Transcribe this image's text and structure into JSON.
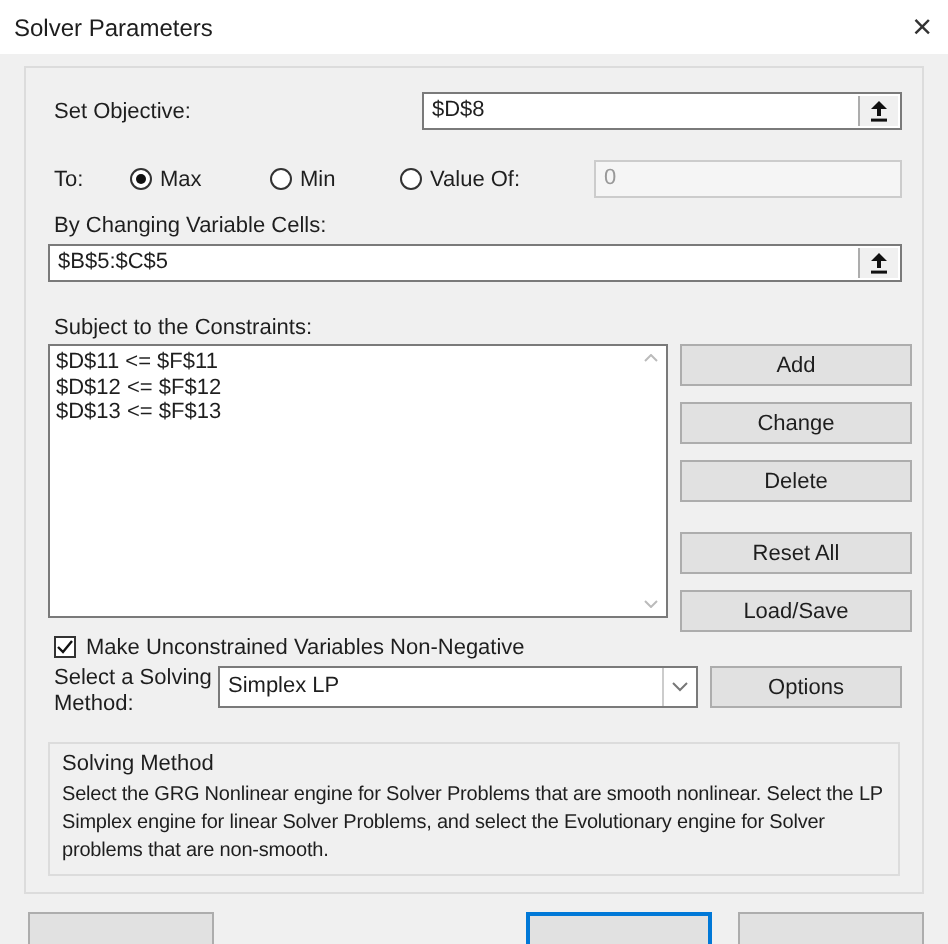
{
  "window": {
    "title": "Solver Parameters",
    "close": "×"
  },
  "objective": {
    "label": "Set Objective:",
    "value": "$D$8"
  },
  "to": {
    "label": "To:",
    "options": [
      {
        "label": "Max",
        "selected": true
      },
      {
        "label": "Min",
        "selected": false
      },
      {
        "label": "Value Of:",
        "selected": false
      }
    ],
    "value_field": {
      "value": "0",
      "disabled": true
    }
  },
  "changing_cells": {
    "label": "By Changing Variable Cells:",
    "value": "$B$5:$C$5"
  },
  "constraints": {
    "label": "Subject to the Constraints:",
    "items": [
      "$D$11 <= $F$11",
      "$D$12 <= $F$12",
      "$D$13 <= $F$13"
    ]
  },
  "side_button_groups": [
    [
      "Add",
      "Change",
      "Delete"
    ],
    [
      "Reset All",
      "Load/Save"
    ]
  ],
  "nonnegative": {
    "label": "Make Unconstrained Variables Non-Negative",
    "checked": true
  },
  "method": {
    "label": "Select a Solving Method:",
    "value": "Simplex LP",
    "options_button": "Options"
  },
  "method_info": {
    "title": "Solving Method",
    "text": "Select the GRG Nonlinear engine for Solver Problems that are smooth nonlinear. Select the LP Simplex engine for linear Solver Problems, and select the Evolutionary engine for Solver problems that are non-smooth."
  },
  "bottom_buttons": [
    {
      "default": false
    },
    {
      "default": true
    },
    {
      "default": false
    }
  ]
}
